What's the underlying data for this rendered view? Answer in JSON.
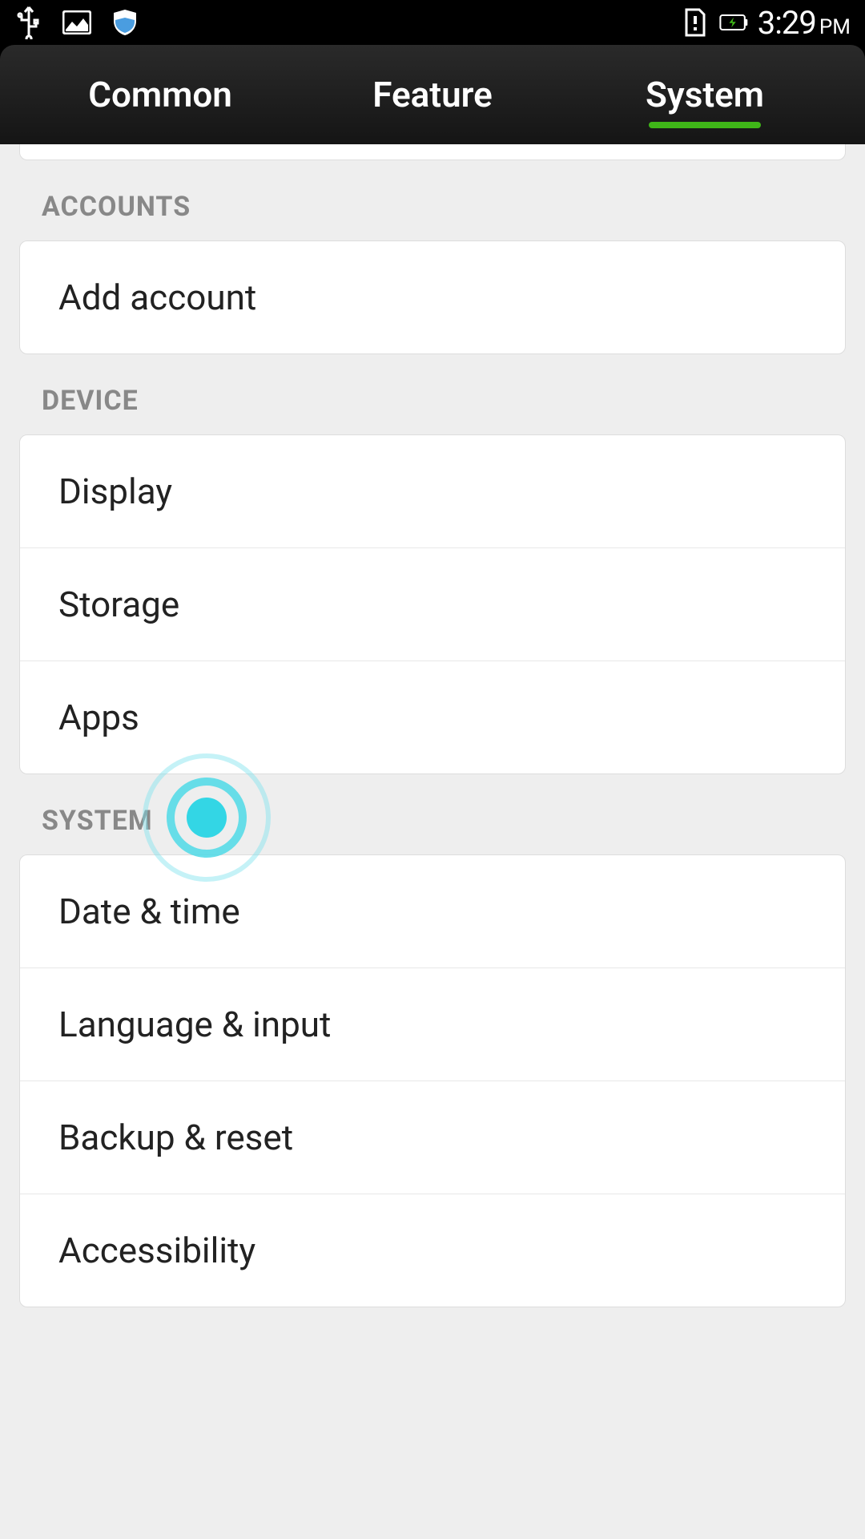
{
  "status_bar": {
    "time": "3:29",
    "ampm": "PM"
  },
  "tabs": {
    "common": "Common",
    "feature": "Feature",
    "system": "System"
  },
  "sections": {
    "accounts": {
      "header": "ACCOUNTS",
      "items": {
        "add_account": "Add account"
      }
    },
    "device": {
      "header": "DEVICE",
      "items": {
        "display": "Display",
        "storage": "Storage",
        "apps": "Apps"
      }
    },
    "system": {
      "header": "SYSTEM",
      "items": {
        "date_time": "Date & time",
        "language_input": "Language & input",
        "backup_reset": "Backup & reset",
        "accessibility": "Accessibility"
      }
    }
  }
}
